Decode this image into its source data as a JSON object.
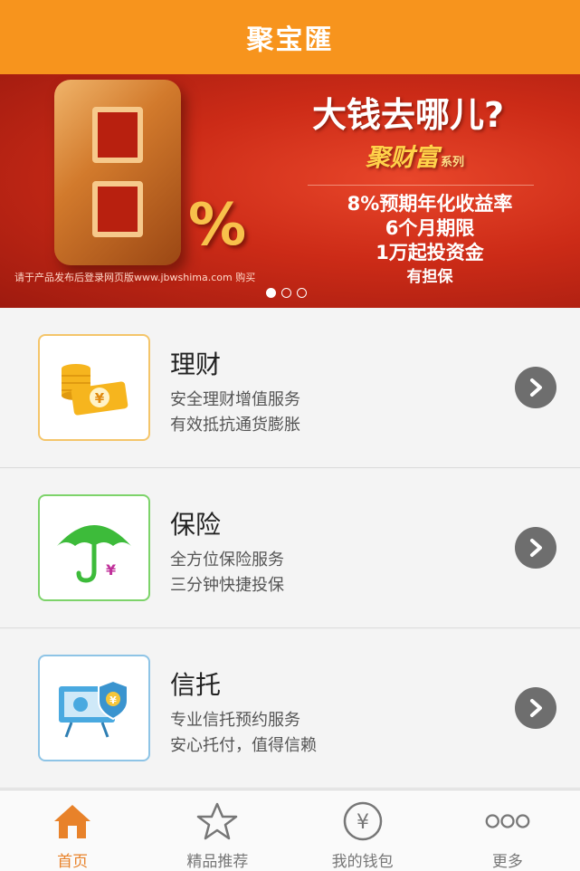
{
  "header": {
    "title": "聚宝匯"
  },
  "banner": {
    "headline": "大钱去哪儿?",
    "series_name": "聚财富",
    "series_suffix": "系列",
    "big_digit": "8",
    "percent_sign": "%",
    "lines": [
      "8%预期年化收益率",
      "6个月期限",
      "1万起投资金",
      "有担保"
    ],
    "footnote": "请于产品发布后登录网页版www.jbwshima.com 购买",
    "carousel": {
      "count": 3,
      "active": 1
    }
  },
  "services": [
    {
      "title": "理财",
      "line1": "安全理财增值服务",
      "line2": "有效抵抗通货膨胀",
      "icon": "coins-money-icon",
      "border_color": "#f4c56a"
    },
    {
      "title": "保险",
      "line1": "全方位保险服务",
      "line2": "三分钟快捷投保",
      "icon": "umbrella-icon",
      "border_color": "#7dd36a"
    },
    {
      "title": "信托",
      "line1": "专业信托预约服务",
      "line2": "安心托付，值得信赖",
      "icon": "trust-certificate-icon",
      "border_color": "#8ec4e6"
    }
  ],
  "tabbar": {
    "active_color": "#e8822a",
    "items": [
      {
        "label": "首页",
        "icon": "home-icon",
        "active": true
      },
      {
        "label": "精品推荐",
        "icon": "star-icon",
        "active": false
      },
      {
        "label": "我的钱包",
        "icon": "wallet-yen-icon",
        "active": false
      },
      {
        "label": "更多",
        "icon": "more-dots-icon",
        "active": false
      }
    ]
  }
}
